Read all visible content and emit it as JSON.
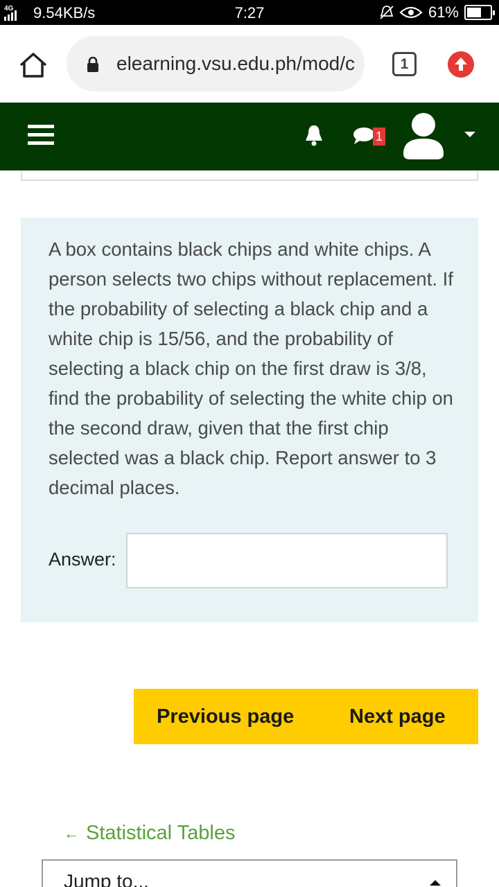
{
  "status_bar": {
    "network_type": "4G",
    "speed": "9.54KB/s",
    "time": "7:27",
    "battery": "61%",
    "battery_fraction": 0.61
  },
  "browser": {
    "url": "elearning.vsu.edu.ph/mod/c",
    "tab_count": "1"
  },
  "header": {
    "message_badge": "1",
    "bg_color": "#033803"
  },
  "question": {
    "text": "A box contains black chips and white chips. A person selects two chips without replacement. If the probability of selecting a black chip and a white chip is 15/56, and the probability of selecting a black chip on the first draw is 3/8, find the probability of selecting the white chip on the second draw, given that the first chip selected was a black chip. Report answer to 3 decimal places.",
    "answer_label": "Answer:",
    "answer_value": ""
  },
  "navigation": {
    "previous_label": "Previous page",
    "next_label": "Next page",
    "accent_color": "#ffcc00"
  },
  "footer": {
    "back_link_arrow": "←",
    "back_link_label": "Statistical Tables",
    "jump_label": "Jump to..."
  }
}
